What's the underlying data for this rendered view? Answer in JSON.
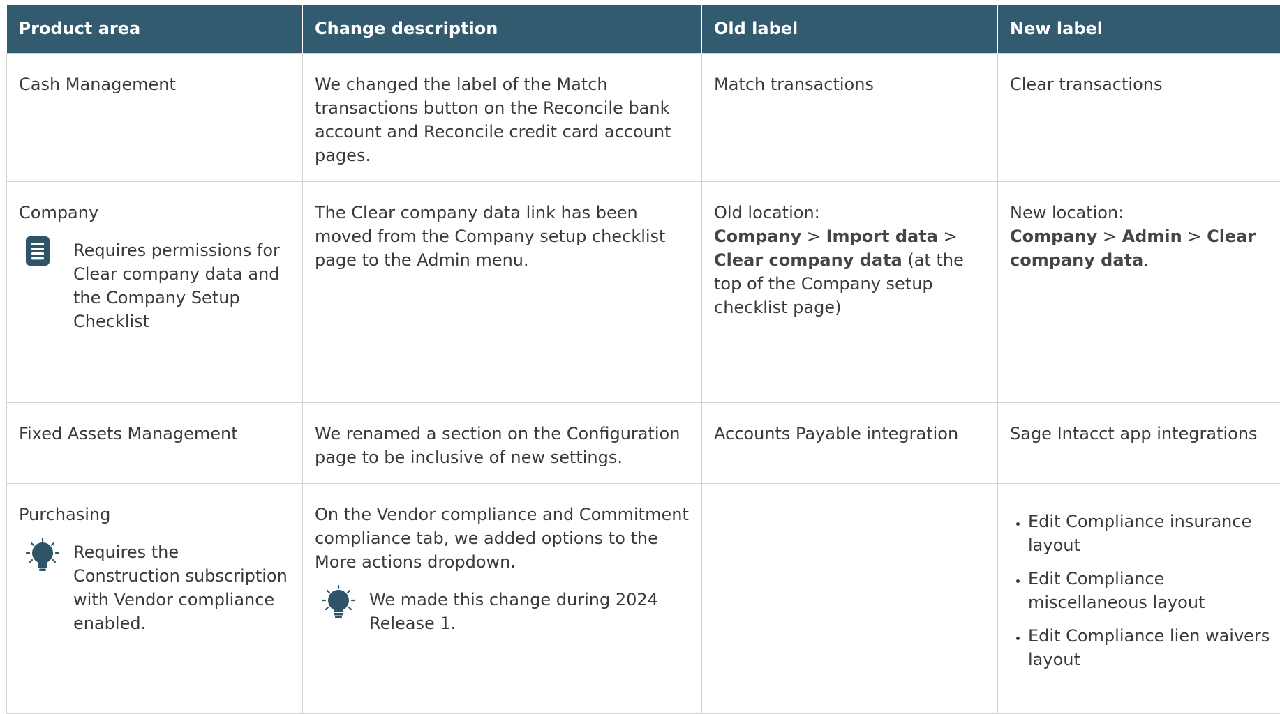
{
  "columns": [
    "Product area",
    "Change description",
    "Old label",
    "New label"
  ],
  "rows": [
    {
      "area": "Cash Management",
      "description": "We changed the label of the Match transactions button on the Reconcile bank account and Reconcile credit card account pages.",
      "old_label": "Match transactions",
      "new_label": "Clear transactions"
    },
    {
      "area": "Company",
      "area_note": {
        "icon": "document-icon",
        "text": "Requires permissions for Clear company data and the Company Setup Checklist"
      },
      "description": "The Clear company data link has been moved from the Company setup checklist page to the Admin menu.",
      "old_label": {
        "prefix": "Old location:",
        "path": [
          "Company",
          ">",
          "Import data",
          ">",
          "Clear company data"
        ],
        "suffix": " (at the top of the Company setup checklist page)"
      },
      "new_label": {
        "prefix": "New location:",
        "path": [
          "Company",
          ">",
          "Admin",
          ">",
          "Clear company data"
        ],
        "suffix": "."
      }
    },
    {
      "area": "Fixed Assets Management",
      "description": "We renamed a section on the Configuration page to be inclusive of new settings.",
      "old_label": "Accounts Payable integration",
      "new_label": "Sage Intacct app integrations"
    },
    {
      "area": "Purchasing",
      "area_note": {
        "icon": "lightbulb-icon",
        "text": "Requires the Construction subscription with Vendor compliance enabled."
      },
      "description": "On the Vendor compliance and Commitment compliance tab, we added options to the More actions dropdown.",
      "description_note": {
        "icon": "lightbulb-icon",
        "text": "We made this change during 2024 Release 1."
      },
      "old_label": "",
      "new_label_items": [
        "Edit Compliance insurance layout",
        "Edit Compliance miscellaneous layout",
        "Edit Compliance lien waivers layout"
      ]
    }
  ],
  "colors": {
    "header_bg": "#335b70",
    "header_text": "#ffffff",
    "icon": "#2f5468",
    "border": "#d2d2d2"
  }
}
